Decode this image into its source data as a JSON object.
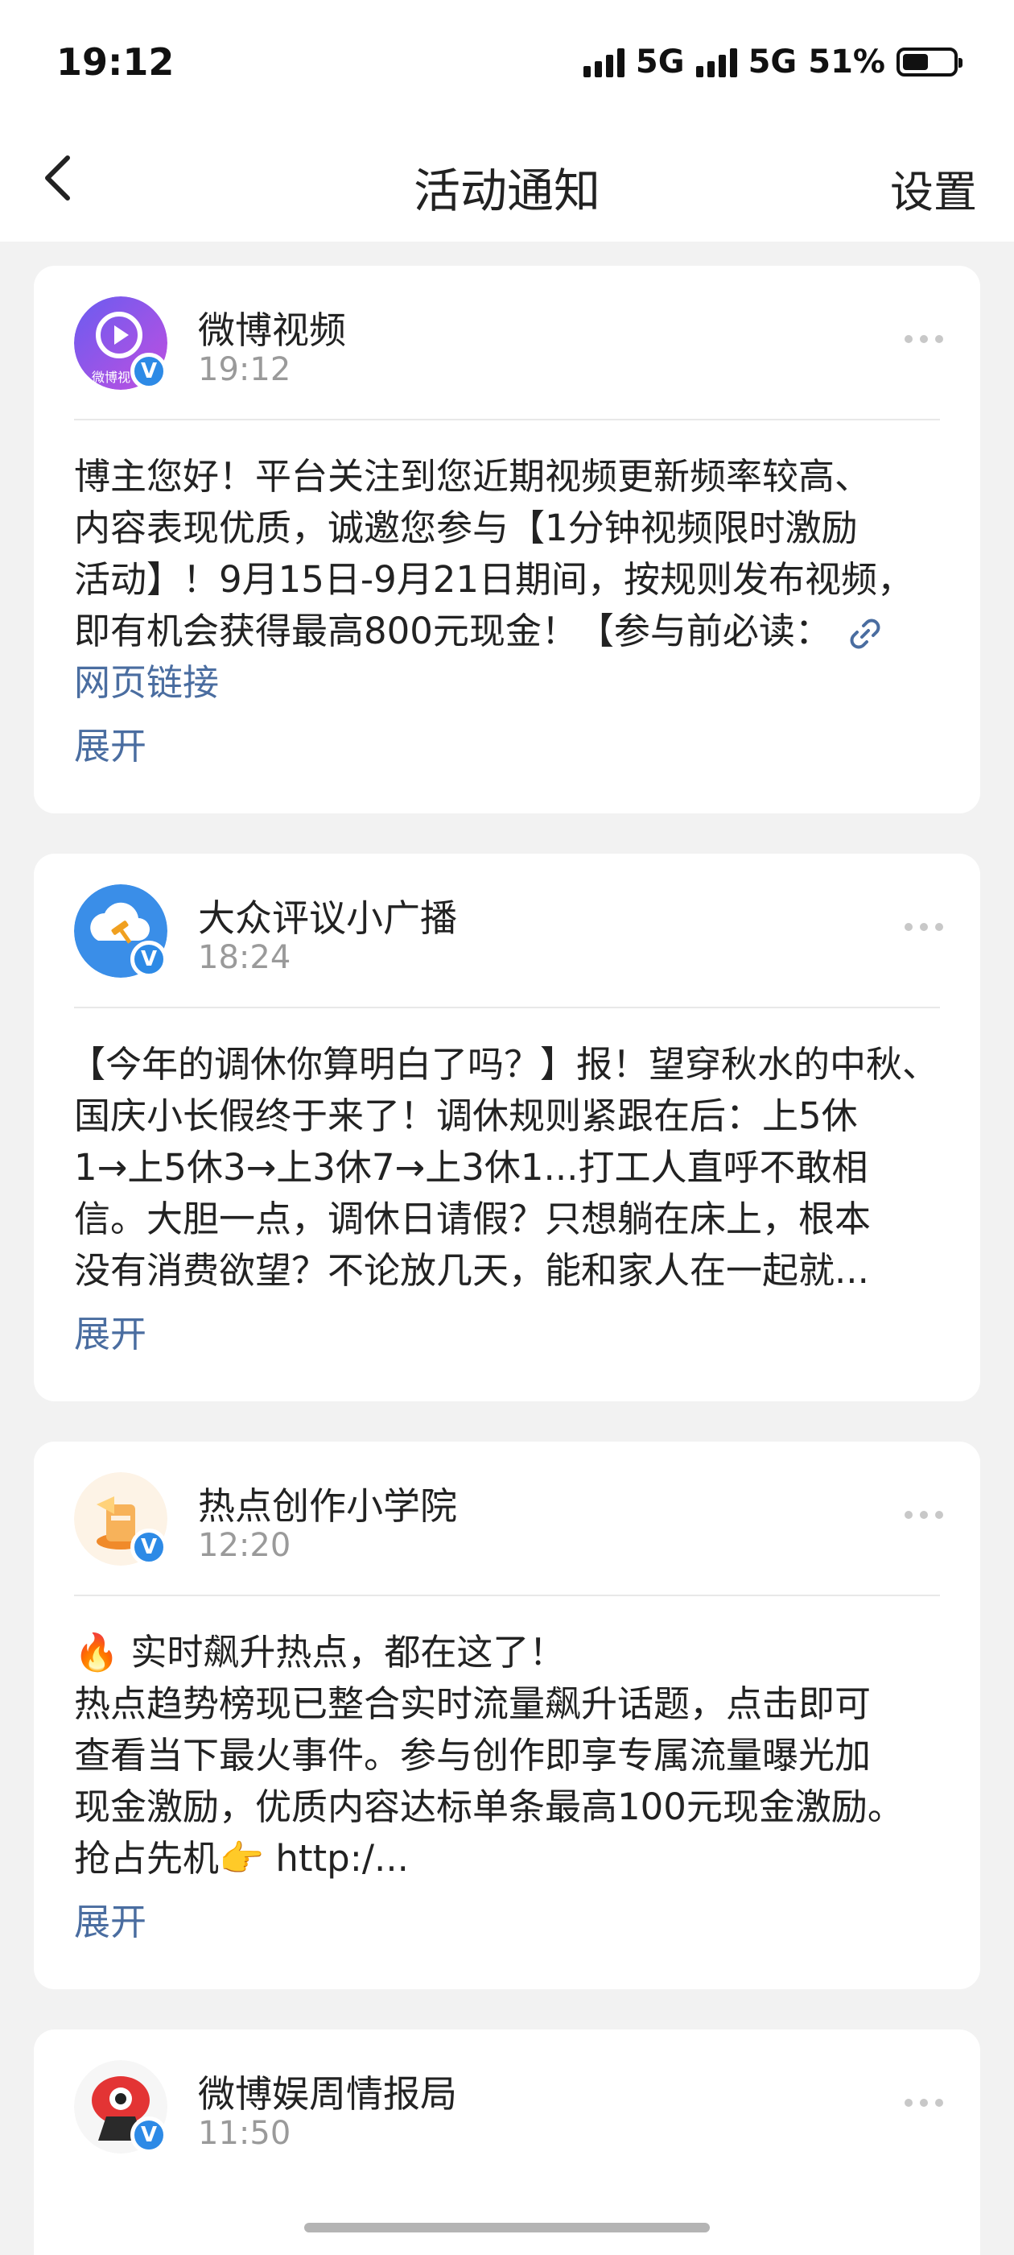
{
  "status_bar": {
    "time": "19:12",
    "network1": "5G",
    "network2": "5G",
    "battery": "51%",
    "battery_level": 0.51
  },
  "nav": {
    "title": "活动通知",
    "settings_label": "设置",
    "back_icon": "chevron-left-icon"
  },
  "notifications": [
    {
      "sender": "微博视频",
      "time": "19:12",
      "avatar_label": "微博视",
      "lines": [
        "博主您好！平台关注到您近期视频更新频率较高、",
        "内容表现优质，诚邀您参与【1分钟视频限时激励",
        "活动】！9月15日-9月21日期间，按规则发布视频，",
        "即有机会获得最高800元现金！【参与前必读："
      ],
      "link_text": "网页链接",
      "expand_label": "展开"
    },
    {
      "sender": "大众评议小广播",
      "time": "18:24",
      "lines": [
        "【今年的调休你算明白了吗？】报！望穿秋水的中秋、",
        "国庆小长假终于来了！调休规则紧跟在后：上5休",
        "1→上5休3→上3休7→上3休1...打工人直呼不敢相",
        "信。大胆一点，调休日请假？只想躺在床上，根本",
        "没有消费欲望？不论放几天，能和家人在一起就..."
      ],
      "expand_label": "展开"
    },
    {
      "sender": "热点创作小学院",
      "time": "12:20",
      "lines": [
        "🔥 实时飙升热点，都在这了！",
        "热点趋势榜现已整合实时流量飙升话题，点击即可",
        "查看当下最火事件。参与创作即享专属流量曝光加",
        "现金激励，优质内容达标单条最高100元现金激励。",
        "抢占先机👉 http:/..."
      ],
      "expand_label": "展开"
    },
    {
      "sender": "微博娱周情报局",
      "time": "11:50"
    }
  ],
  "colors": {
    "accent_link": "#4a6da0",
    "verified_badge": "#2d8ae6",
    "background": "#f2f2f2"
  }
}
